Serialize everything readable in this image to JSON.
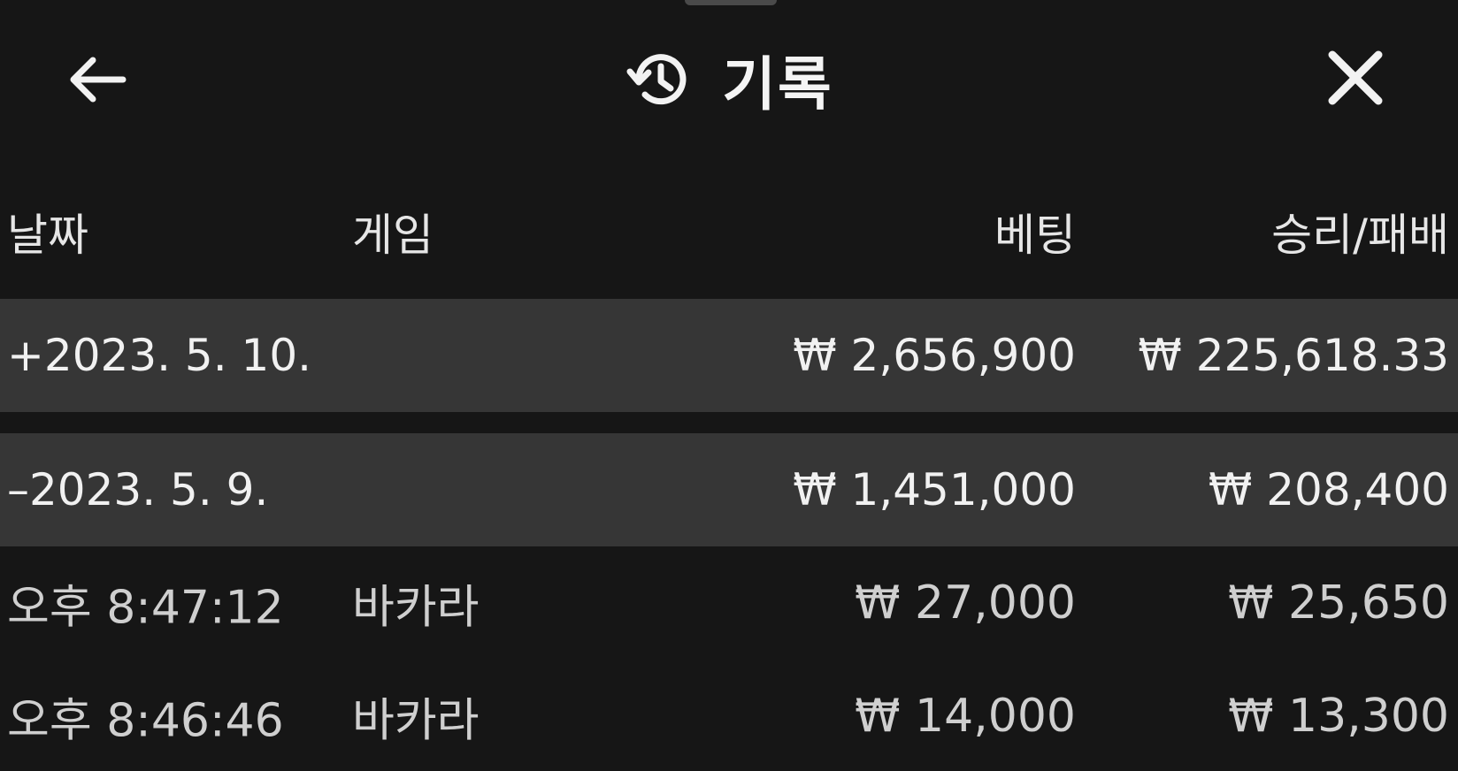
{
  "header": {
    "title": "기록",
    "back_icon": "arrow-left-icon",
    "history_icon": "history-clock-icon",
    "close_icon": "close-icon"
  },
  "columns": {
    "date": "날짜",
    "game": "게임",
    "bet": "베팅",
    "win_loss": "승리/패배"
  },
  "days": [
    {
      "toggle_date": "+2023. 5. 10.",
      "game": "",
      "bet": "₩ 2,656,900",
      "win_loss": "₩ 225,618.33"
    },
    {
      "toggle_date": "–2023. 5. 9.",
      "game": "",
      "bet": "₩ 1,451,000",
      "win_loss": "₩ 208,400"
    }
  ],
  "entries": [
    {
      "time": "오후 8:47:12",
      "game": "바카라",
      "bet": "₩ 27,000",
      "win_loss": "₩ 25,650"
    },
    {
      "time": "오후 8:46:46",
      "game": "바카라",
      "bet": "₩ 14,000",
      "win_loss": "₩ 13,300"
    }
  ],
  "colors": {
    "background": "#161616",
    "day_row": "#363636",
    "text": "#ececec"
  }
}
